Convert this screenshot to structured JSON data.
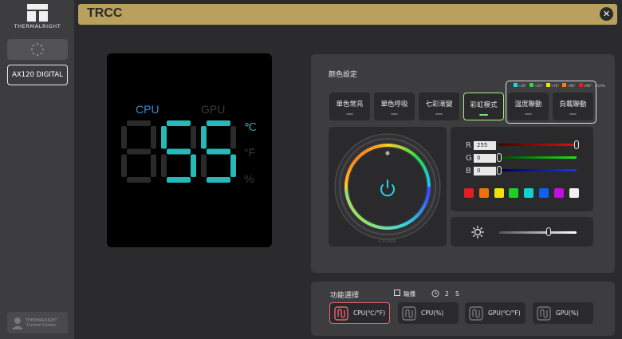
{
  "app": {
    "title": "TRCC",
    "close_glyph": "✕"
  },
  "sidebar": {
    "logo_text": "THERMALRIGHT",
    "device_button": "AX120 DIGITAL",
    "footer_brand": "THERMALRIGHT",
    "footer_label": "Control Center"
  },
  "preview": {
    "label_cpu": "CPU",
    "label_gpu": "GPU",
    "unit_c": "℃",
    "unit_f": "°F",
    "unit_pct": "%",
    "value": "55",
    "active_color": "#27b8b8",
    "inactive_color": "#2a2a2a"
  },
  "color_settings": {
    "title": "颜色設定",
    "modes": [
      {
        "label": "單色常亮",
        "active": false
      },
      {
        "label": "單色呼吸",
        "active": false
      },
      {
        "label": "七彩漸變",
        "active": false
      },
      {
        "label": "彩虹模式",
        "active": true
      },
      {
        "label": "溫度聯動",
        "active": false
      },
      {
        "label": "負載聯動",
        "active": false
      }
    ],
    "legend": [
      {
        "label": "<30°",
        "color": "#2fd0e0"
      },
      {
        "label": "<50°",
        "color": "#39d039"
      },
      {
        "label": "<70°",
        "color": "#e8e020"
      },
      {
        "label": "<90°",
        "color": "#f08020"
      },
      {
        "label": ">90°",
        "color": "#e02020"
      },
      {
        "label": "(℃/%)",
        "color": ""
      }
    ],
    "wheel_label": "COLOR",
    "rgb": {
      "r_label": "R",
      "r_value": "255",
      "g_label": "G",
      "g_value": "0",
      "b_label": "B",
      "b_value": "0"
    },
    "swatches": [
      "#e02020",
      "#f07010",
      "#f0e010",
      "#20d020",
      "#10d0d0",
      "#1060f0",
      "#c010e0",
      "#f0f0f0"
    ],
    "brightness_level": 0.64
  },
  "function": {
    "title": "功能選擇",
    "carousel_label": "輪播",
    "interval_value": "2",
    "interval_unit": "S",
    "buttons": [
      {
        "label": "CPU(℃/°F)",
        "active": true
      },
      {
        "label": "CPU(%)",
        "active": false
      },
      {
        "label": "GPU(℃/°F)",
        "active": false
      },
      {
        "label": "GPU(%)",
        "active": false
      }
    ]
  }
}
